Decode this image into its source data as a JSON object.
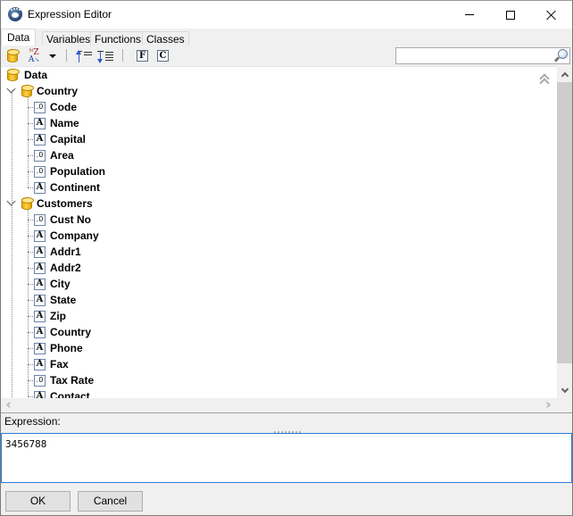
{
  "window": {
    "title": "Expression Editor",
    "app_icon": "paw-icon",
    "controls": {
      "minimize": "minimize-icon",
      "maximize": "maximize-icon",
      "close": "close-icon"
    }
  },
  "tabs": [
    {
      "label": "Data",
      "active": true
    },
    {
      "label": "Variables",
      "active": false
    },
    {
      "label": "Functions",
      "active": false
    },
    {
      "label": "Classes",
      "active": false
    }
  ],
  "toolbar": {
    "buttons": [
      {
        "name": "database-icon"
      },
      {
        "name": "sort-az-icon"
      },
      {
        "name": "dropdown-arrow-icon"
      },
      {
        "name": "move-up-icon"
      },
      {
        "name": "move-down-icon"
      },
      {
        "name": "fields-icon",
        "glyph": "F"
      },
      {
        "name": "classes-icon",
        "glyph": "C"
      }
    ],
    "search": {
      "value": "",
      "placeholder": ""
    }
  },
  "tree": {
    "root": {
      "label": "Data"
    },
    "groups": [
      {
        "label": "Country",
        "expanded": true,
        "fields": [
          {
            "label": "Code",
            "type": "numeric",
            "glyph": ".0"
          },
          {
            "label": "Name",
            "type": "string",
            "glyph": "A"
          },
          {
            "label": "Capital",
            "type": "string",
            "glyph": "A"
          },
          {
            "label": "Area",
            "type": "numeric",
            "glyph": ".0"
          },
          {
            "label": "Population",
            "type": "numeric",
            "glyph": ".0"
          },
          {
            "label": "Continent",
            "type": "string",
            "glyph": "A"
          }
        ]
      },
      {
        "label": "Customers",
        "expanded": true,
        "fields": [
          {
            "label": "Cust No",
            "type": "numeric",
            "glyph": ".0"
          },
          {
            "label": "Company",
            "type": "string",
            "glyph": "A"
          },
          {
            "label": "Addr1",
            "type": "string",
            "glyph": "A"
          },
          {
            "label": "Addr2",
            "type": "string",
            "glyph": "A"
          },
          {
            "label": "City",
            "type": "string",
            "glyph": "A"
          },
          {
            "label": "State",
            "type": "string",
            "glyph": "A"
          },
          {
            "label": "Zip",
            "type": "string",
            "glyph": "A"
          },
          {
            "label": "Country",
            "type": "string",
            "glyph": "A"
          },
          {
            "label": "Phone",
            "type": "string",
            "glyph": "A"
          },
          {
            "label": "Fax",
            "type": "string",
            "glyph": "A"
          },
          {
            "label": "Tax Rate",
            "type": "numeric",
            "glyph": ".0"
          },
          {
            "label": "Contact",
            "type": "string",
            "glyph": "A"
          }
        ]
      }
    ]
  },
  "expression": {
    "label": "Expression:",
    "value": "3456788"
  },
  "buttons": {
    "ok": "OK",
    "cancel": "Cancel"
  }
}
